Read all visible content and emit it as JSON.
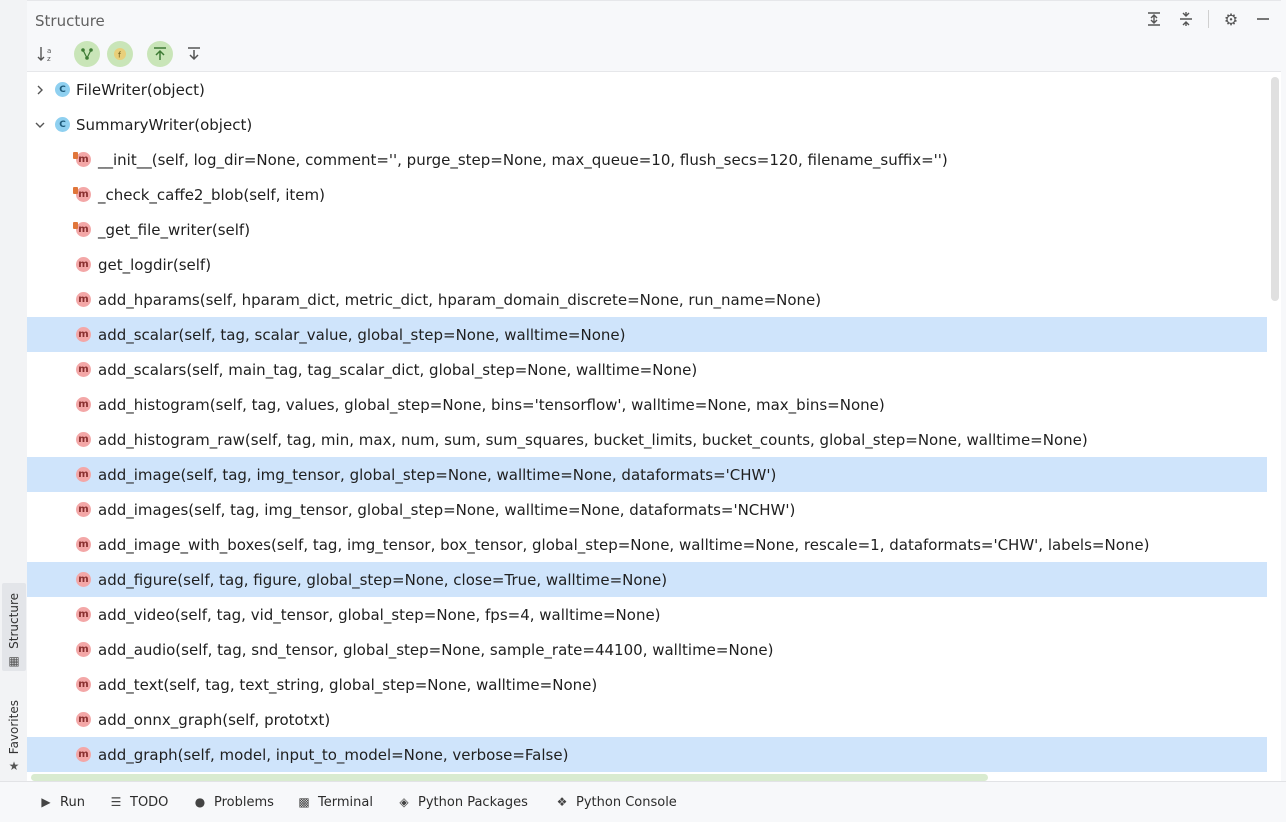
{
  "side_tabs": {
    "structure_label": "Structure",
    "favorites_label": "Favorites"
  },
  "panel": {
    "title": "Structure"
  },
  "tree": {
    "classes": [
      {
        "label": "FileWriter(object)",
        "expanded": false
      },
      {
        "label": "SummaryWriter(object)",
        "expanded": true
      }
    ],
    "methods": [
      {
        "label": "__init__(self, log_dir=None, comment='', purge_step=None, max_queue=10, flush_secs=120, filename_suffix='')",
        "private": true,
        "selected": false
      },
      {
        "label": "_check_caffe2_blob(self, item)",
        "private": true,
        "selected": false
      },
      {
        "label": "_get_file_writer(self)",
        "private": true,
        "selected": false
      },
      {
        "label": "get_logdir(self)",
        "private": false,
        "selected": false
      },
      {
        "label": "add_hparams(self, hparam_dict, metric_dict, hparam_domain_discrete=None, run_name=None)",
        "private": false,
        "selected": false
      },
      {
        "label": "add_scalar(self, tag, scalar_value, global_step=None, walltime=None)",
        "private": false,
        "selected": true
      },
      {
        "label": "add_scalars(self, main_tag, tag_scalar_dict, global_step=None, walltime=None)",
        "private": false,
        "selected": false
      },
      {
        "label": "add_histogram(self, tag, values, global_step=None, bins='tensorflow', walltime=None, max_bins=None)",
        "private": false,
        "selected": false
      },
      {
        "label": "add_histogram_raw(self, tag, min, max, num, sum, sum_squares, bucket_limits, bucket_counts, global_step=None, walltime=None)",
        "private": false,
        "selected": false
      },
      {
        "label": "add_image(self, tag, img_tensor, global_step=None, walltime=None, dataformats='CHW')",
        "private": false,
        "selected": true
      },
      {
        "label": "add_images(self, tag, img_tensor, global_step=None, walltime=None, dataformats='NCHW')",
        "private": false,
        "selected": false
      },
      {
        "label": "add_image_with_boxes(self, tag, img_tensor, box_tensor, global_step=None, walltime=None, rescale=1, dataformats='CHW', labels=None)",
        "private": false,
        "selected": false
      },
      {
        "label": "add_figure(self, tag, figure, global_step=None, close=True, walltime=None)",
        "private": false,
        "selected": true
      },
      {
        "label": "add_video(self, tag, vid_tensor, global_step=None, fps=4, walltime=None)",
        "private": false,
        "selected": false
      },
      {
        "label": "add_audio(self, tag, snd_tensor, global_step=None, sample_rate=44100, walltime=None)",
        "private": false,
        "selected": false
      },
      {
        "label": "add_text(self, tag, text_string, global_step=None, walltime=None)",
        "private": false,
        "selected": false
      },
      {
        "label": "add_onnx_graph(self, prototxt)",
        "private": false,
        "selected": false
      },
      {
        "label": "add_graph(self, model, input_to_model=None, verbose=False)",
        "private": false,
        "selected": true
      }
    ],
    "class_icon_letter": "C",
    "method_icon_letter": "m"
  },
  "bottom_tabs": [
    {
      "label": "Run",
      "icon": "play-icon"
    },
    {
      "label": "TODO",
      "icon": "list-icon"
    },
    {
      "label": "Problems",
      "icon": "alert-icon"
    },
    {
      "label": "Terminal",
      "icon": "terminal-icon"
    },
    {
      "label": "Python Packages",
      "icon": "layers-icon"
    },
    {
      "label": "Python Console",
      "icon": "python-icon"
    }
  ],
  "colors": {
    "selection": "#cfe4fb",
    "active_filter": "#c9e5b8",
    "class_icon": "#8fd0f0",
    "method_icon": "#f3a7a7"
  }
}
